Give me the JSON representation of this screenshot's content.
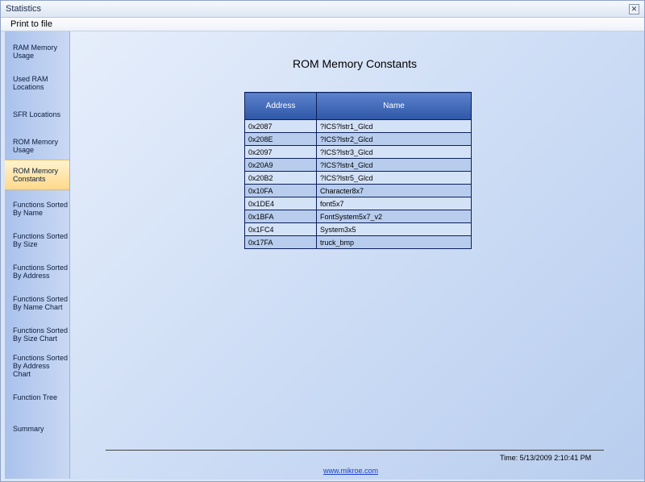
{
  "window": {
    "title": "Statistics"
  },
  "menu": {
    "print": "Print to file"
  },
  "sidebar": {
    "items": [
      {
        "label": "RAM Memory\nUsage"
      },
      {
        "label": "Used RAM\nLocations"
      },
      {
        "label": "SFR Locations"
      },
      {
        "label": "ROM Memory\nUsage"
      },
      {
        "label": "ROM Memory\nConstants"
      },
      {
        "label": "Functions Sorted\nBy  Name"
      },
      {
        "label": "Functions Sorted\nBy Size"
      },
      {
        "label": "Functions Sorted\nBy Address"
      },
      {
        "label": "Functions Sorted\nBy Name Chart"
      },
      {
        "label": "Functions Sorted\nBy Size Chart"
      },
      {
        "label": "Functions Sorted\nBy Address Chart"
      },
      {
        "label": "Function Tree"
      },
      {
        "label": "Summary"
      }
    ]
  },
  "main": {
    "title": "ROM Memory Constants",
    "table": {
      "headers": [
        "Address",
        "Name"
      ],
      "rows": [
        [
          "0x2087",
          "?ICS?lstr1_Glcd"
        ],
        [
          "0x208E",
          "?ICS?lstr2_Glcd"
        ],
        [
          "0x2097",
          "?ICS?lstr3_Glcd"
        ],
        [
          "0x20A9",
          "?ICS?lstr4_Glcd"
        ],
        [
          "0x20B2",
          "?ICS?lstr5_Glcd"
        ],
        [
          "0x10FA",
          "Character8x7"
        ],
        [
          "0x1DE4",
          "font5x7"
        ],
        [
          "0x1BFA",
          "FontSystem5x7_v2"
        ],
        [
          "0x1FC4",
          "System3x5"
        ],
        [
          "0x17FA",
          "truck_bmp"
        ]
      ]
    },
    "time": "Time: 5/13/2009 2:10:41 PM",
    "link": "www.mikroe.com"
  }
}
